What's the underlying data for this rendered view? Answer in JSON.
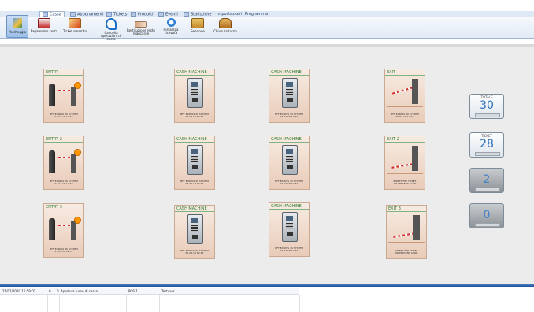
{
  "ribbon": {
    "tabs": [
      {
        "label": "Cassa",
        "active": true
      },
      {
        "label": "Abbonamenti",
        "active": false
      },
      {
        "label": "Tickets",
        "active": false
      },
      {
        "label": "Prodotti",
        "active": false
      },
      {
        "label": "Eventi",
        "active": false
      },
      {
        "label": "Statistiche",
        "active": false
      },
      {
        "label": "Impostazioni",
        "active": false
      },
      {
        "label": "Programma",
        "active": false
      }
    ],
    "parking_button": {
      "label": "Parcheggio",
      "icon": "parking-map-icon"
    },
    "buttons": [
      {
        "label": "Pagamento sosta",
        "icon": "cash-register-icon"
      },
      {
        "label": "Ticket smarrito",
        "icon": "lost-ticket-icon"
      },
      {
        "label": "Cancella operazioni di cassa",
        "icon": "undo-arrow-icon"
      },
      {
        "label": "Restituzione resto mancante",
        "icon": "money-return-icon"
      },
      {
        "label": "Ristampa ricevuta",
        "icon": "receipt-icon"
      },
      {
        "label": "Sessione",
        "icon": "session-icon"
      },
      {
        "label": "Chiusura turno",
        "icon": "cash-box-icon"
      }
    ]
  },
  "devices": [
    {
      "title": "ENTRY",
      "line1": "BFT EXPASS 30 SYSTEM",
      "line2": "07.02.18  12:32",
      "kind": "entry"
    },
    {
      "title": "CASH MACHINE",
      "line1": "BFT EXPASS 30 SYSTEM",
      "line2": "07.02.18  12:31",
      "kind": "cash"
    },
    {
      "title": "CASH MACHINE",
      "line1": "BFT EXPASS 30 SYSTEM",
      "line2": "07.02.18  12:31",
      "kind": "cash"
    },
    {
      "title": "EXIT",
      "line1": "BFT EXPASS 30 SYSTEM",
      "line2": "07.02.18  12:32",
      "kind": "exit"
    },
    {
      "title": "ENTRY 2",
      "line1": "BFT EXPASS 30 SYSTEM",
      "line2": "07.02.18  12:32",
      "kind": "entry"
    },
    {
      "title": "CASH MACHINE",
      "line1": "BFT EXPASS 30 SYSTEM",
      "line2": "07.02.18  12:31",
      "kind": "cash"
    },
    {
      "title": "CASH MACHINE",
      "line1": "BFT EXPASS 30 SYSTEM",
      "line2": "07.02.18  12:31",
      "kind": "cash"
    },
    {
      "title": "EXIT 2",
      "line1": "INSERT THE TICKET",
      "line2": "OR PRESENT CARD",
      "kind": "exit2"
    },
    {
      "title": "ENTRY 3",
      "line1": "BFT EXPASS 30 SYSTEM",
      "line2": "07.02.18  12:32",
      "kind": "entry"
    },
    {
      "title": "CASH MACHINE",
      "line1": "BFT EXPASS 30 SYSTEM",
      "line2": "07.02.18  12:31",
      "kind": "cash"
    },
    {
      "title": "CASH MACHINE",
      "line1": "BFT EXPASS 30 SYSTEM",
      "line2": "07.02.18  12:31",
      "kind": "cash"
    },
    {
      "title": "EXIT 3",
      "line1": "INSERT THE TICKET",
      "line2": "OR PRESENT CARD",
      "kind": "exit2"
    }
  ],
  "counters": [
    {
      "label": "TOTALE",
      "value": "30",
      "style": "light"
    },
    {
      "label": "TICKET",
      "value": "28",
      "style": "light"
    },
    {
      "label": "",
      "value": "2",
      "style": "dark"
    },
    {
      "label": "",
      "value": "0",
      "style": "dark"
    }
  ],
  "log": {
    "rows": [
      {
        "datetime": "21/02/2020 15:59:01",
        "col2": "0",
        "col3": "0",
        "desc": "Apertura turno di cassa",
        "pos": "POS 1",
        "terminal": "Testuser"
      }
    ]
  }
}
